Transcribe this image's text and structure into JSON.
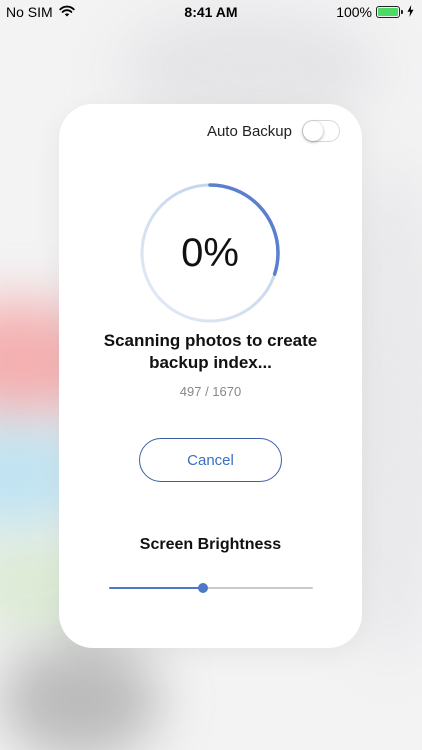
{
  "status_bar": {
    "carrier": "No SIM",
    "time": "8:41 AM",
    "battery_percent": "100%",
    "battery_level": 1.0,
    "icons": [
      "wifi-icon",
      "battery-icon",
      "charging-bolt-icon"
    ]
  },
  "auto_backup": {
    "label": "Auto Backup",
    "enabled": false
  },
  "progress": {
    "percent_label": "0%",
    "ring_fill_fraction": 0.3,
    "ring_colors": [
      "#d6e2f1",
      "#5a7fcf"
    ]
  },
  "scan": {
    "line1": "Scanning photos to create",
    "line2": "backup index...",
    "count": "497 / 1670"
  },
  "cancel_label": "Cancel",
  "brightness": {
    "label": "Screen Brightness",
    "value": 0.46
  },
  "colors": {
    "accent": "#4f77c7",
    "toggle_off": "#ffffff",
    "battery": "#4cd964"
  }
}
